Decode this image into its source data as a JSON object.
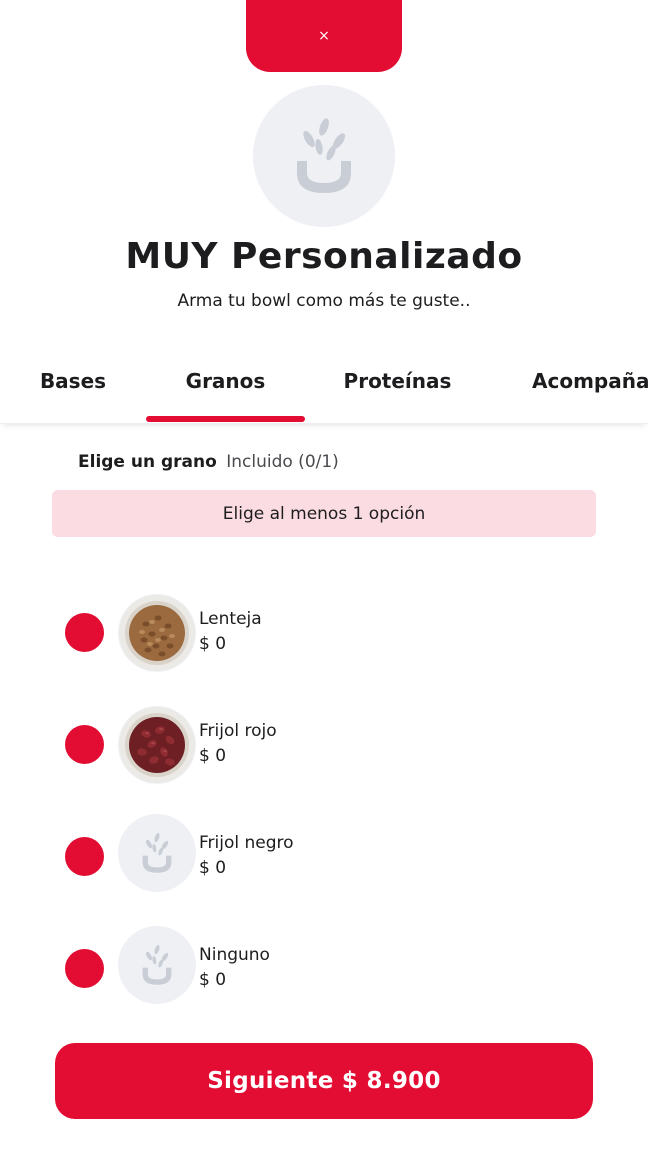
{
  "modal": {
    "close_label": "×"
  },
  "header": {
    "title": "MUY Personalizado",
    "subtitle": "Arma tu bowl como más te guste.."
  },
  "tabs": [
    {
      "label": "Bases",
      "active": false
    },
    {
      "label": "Granos",
      "active": true
    },
    {
      "label": "Proteínas",
      "active": false
    },
    {
      "label": "Acompañantes",
      "active": false
    }
  ],
  "section": {
    "title": "Elige un grano",
    "subtitle": "Incluido (0/1)",
    "notice": "Elige al menos 1 opción"
  },
  "options": [
    {
      "name": "Lenteja",
      "price": "$ 0",
      "image": "lentils-photo"
    },
    {
      "name": "Frijol rojo",
      "price": "$ 0",
      "image": "red-beans-photo"
    },
    {
      "name": "Frijol negro",
      "price": "$ 0",
      "image": "placeholder-logo"
    },
    {
      "name": "Ninguno",
      "price": "$ 0",
      "image": "placeholder-logo"
    }
  ],
  "footer": {
    "next_label": "Siguiente $ 8.900"
  },
  "colors": {
    "accent": "#e30d33",
    "notice_bg": "#fadce2",
    "placeholder_bg": "#eef0f4"
  }
}
